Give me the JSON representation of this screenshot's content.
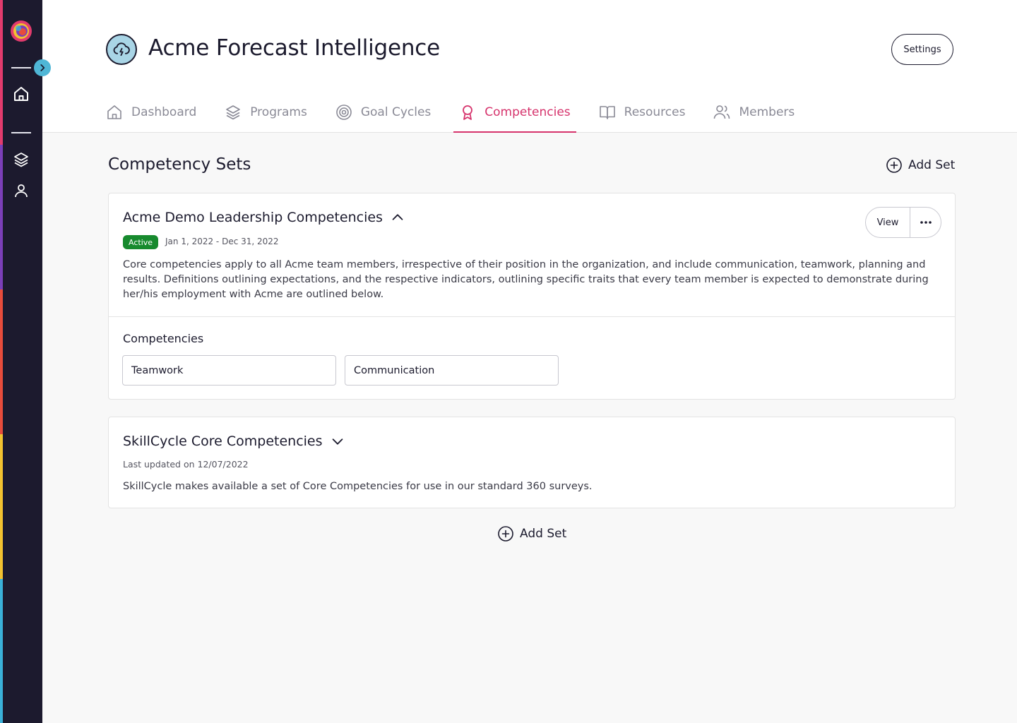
{
  "app": {
    "title": "Acme Forecast Intelligence",
    "settings_label": "Settings"
  },
  "rail": {
    "icons": [
      "app-logo",
      "home-icon",
      "layers-icon",
      "user-icon"
    ],
    "stripe_colors": [
      "#e23b6d",
      "#7b3fb8",
      "#e74c3c",
      "#f2c230",
      "#3ab0d8"
    ]
  },
  "tabs": [
    {
      "label": "Dashboard",
      "icon": "home-icon",
      "active": false
    },
    {
      "label": "Programs",
      "icon": "layers-icon",
      "active": false
    },
    {
      "label": "Goal Cycles",
      "icon": "target-icon",
      "active": false
    },
    {
      "label": "Competencies",
      "icon": "award-icon",
      "active": true
    },
    {
      "label": "Resources",
      "icon": "book-icon",
      "active": false
    },
    {
      "label": "Members",
      "icon": "users-icon",
      "active": false
    }
  ],
  "main": {
    "section_title": "Competency Sets",
    "add_set_label": "Add Set"
  },
  "sets": [
    {
      "title": "Acme Demo Leadership Competencies",
      "expanded": true,
      "status": "Active",
      "date_range": "Jan 1, 2022 - Dec 31, 2022",
      "description": "Core competencies apply to all Acme team members, irrespective of their position in the organization, and include communication, teamwork, planning and results. Definitions outlining expectations, and the respective indicators, outlining specific traits that every team member is expected to demonstrate during her/his employment with Acme are outlined below.",
      "competencies_label": "Competencies",
      "competencies": [
        "Teamwork",
        "Communication"
      ],
      "view_label": "View"
    },
    {
      "title": "SkillCycle Core Competencies",
      "expanded": false,
      "updated": "Last updated on 12/07/2022",
      "description": "SkillCycle makes available a set of Core Competencies for use in our standard 360 surveys."
    }
  ],
  "colors": {
    "accent": "#d6336c",
    "active_badge": "#178a2e",
    "rail_bg": "#1c1a2e",
    "toggle": "#4fb6d6"
  }
}
